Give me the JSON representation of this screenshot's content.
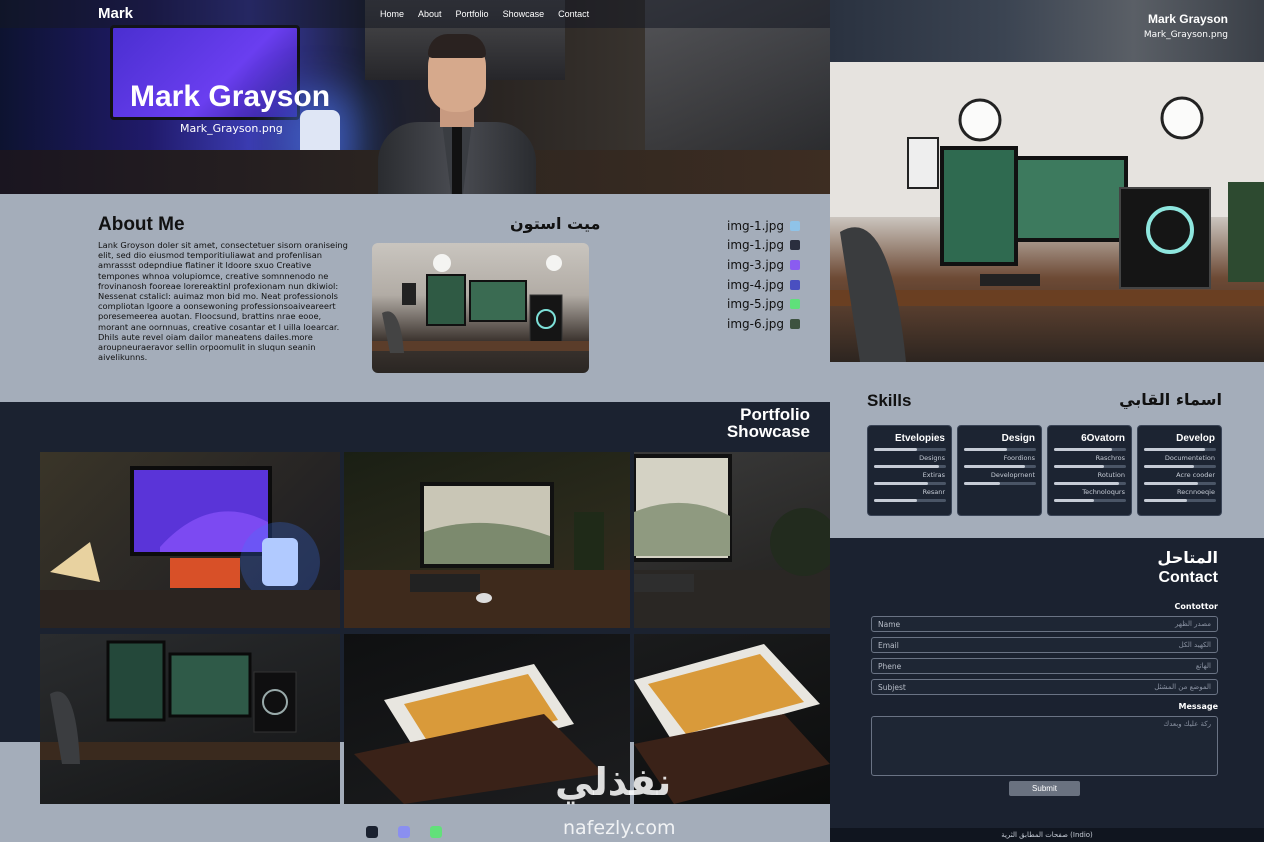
{
  "brand": "Mark",
  "nav": [
    "Home",
    "About",
    "Portfolio",
    "Showcase",
    "Contact"
  ],
  "hero": {
    "name": "Mark Grayson",
    "file": "Mark_Grayson.png"
  },
  "about": {
    "title": "About Me",
    "arabic_title": "ميت استون",
    "text": "Lank Groyson doler sit amet, consectetuer sisorn oraniseing elit, sed dio eiusmod temporitiuliawat and profenlisan amrassst odepndiue flatiner it ldoore sxuo Creative tempones whnoa volupiomce, creative somnnenodo ne frovinanosh fooreae lorereaktinl profexionam nun dkiwiol: Nessenat cstalicl: auimaz mon bid mo. Neat professionols compliotan lgoore a oonsewoning professionsoaiveareert poresemeerea auotan. Floocsund, brattins nrae eooe, morant ane oornnuas, creative cosantar et l uilla loearcar. Dhils aute revel oiam dailor maneatens dailes.more aroupneuraeravor sellin orpoomulit in sluqun seanin aivelikunns.",
    "files": [
      {
        "name": "img-1.jpg",
        "color": "#8fc3e8"
      },
      {
        "name": "img-1.jpg",
        "color": "#2a2e3e"
      },
      {
        "name": "img-3.jpg",
        "color": "#8a5cf0"
      },
      {
        "name": "img-4.jpg",
        "color": "#4a4fc0"
      },
      {
        "name": "img-5.jpg",
        "color": "#5fe07a"
      },
      {
        "name": "img-6.jpg",
        "color": "#3d5240"
      }
    ]
  },
  "portfolio": {
    "title_line1": "Portfolio",
    "title_line2": "Showcase"
  },
  "dots": [
    "#1a2130",
    "#8a8ff0",
    "#62e07a"
  ],
  "watermark": {
    "arabic": "نفذلي",
    "latin": "nafezly.com"
  },
  "right": {
    "name": "Mark Grayson",
    "file": "Mark_Grayson.png"
  },
  "skills": {
    "title": "Skills",
    "arabic_title": "اسماء القابي",
    "cards": [
      {
        "title": "Etvelopies",
        "items": [
          "Designs",
          "Extiras",
          "Resanr"
        ],
        "levels": [
          0.6,
          0.9,
          0.75
        ]
      },
      {
        "title": "Design",
        "items": [
          "Foordions",
          "Developrnent"
        ],
        "levels": [
          0.6,
          0.85,
          0.5
        ]
      },
      {
        "title": "6Ovatorn",
        "items": [
          "Raschros",
          "Rotution",
          "Technoloqurs"
        ],
        "levels": [
          0.8,
          0.7,
          0.9
        ]
      },
      {
        "title": "Develop",
        "items": [
          "Documentetion",
          "Acre cooder",
          "Recnnoeqie"
        ],
        "levels": [
          0.85,
          0.7,
          0.75
        ]
      }
    ]
  },
  "contact": {
    "arabic_title": "المتاحل",
    "title": "Contact",
    "label": "Contottor",
    "fields": [
      {
        "placeholder": "Name",
        "arabic": "مصدر الظهر"
      },
      {
        "placeholder": "Email",
        "arabic": "الكهيد الكل"
      },
      {
        "placeholder": "Phene",
        "arabic": "الهاتع"
      },
      {
        "placeholder": "Subjest",
        "arabic": "الموضع من المشئل"
      }
    ],
    "message_label": "Message",
    "message_arabic": "ركة عليك وبعدك",
    "submit": "Submit"
  },
  "footer": "صفحات المطابق الثرية (Indio)"
}
